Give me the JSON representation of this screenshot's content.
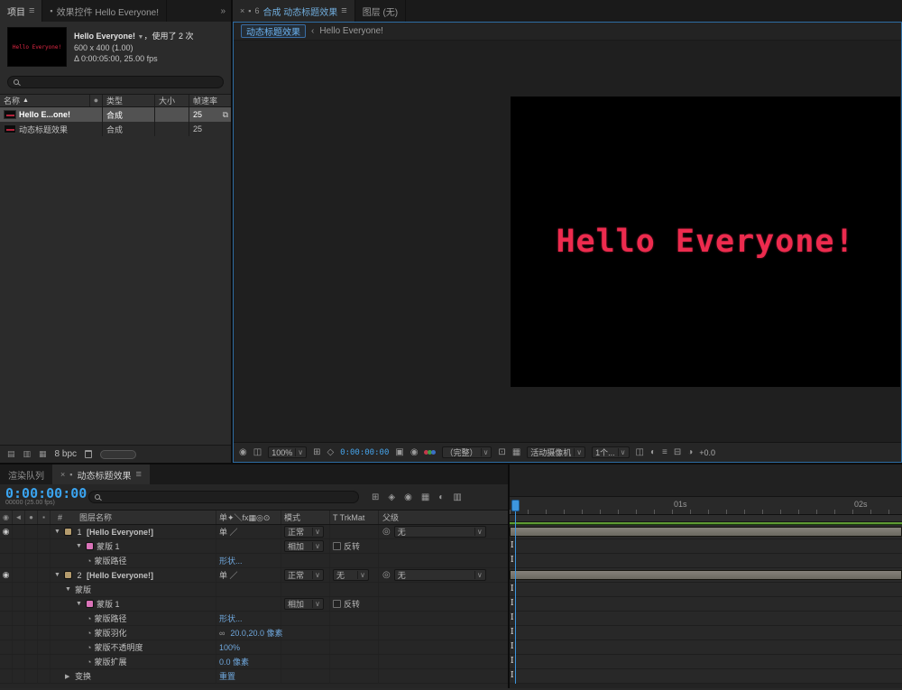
{
  "icons": {
    "menu": "≡",
    "close": "×",
    "overflow": "»",
    "chevron": "∨",
    "sort": "▲",
    "twirl_open": "▼",
    "twirl_closed": "▶",
    "stopwatch": "◔",
    "eye": "◉",
    "pickwhip": "◎",
    "constrain": "∞",
    "crumb_sep": "‹",
    "lock": "6",
    "panel": "▪",
    "eye_head": "◉",
    "audio_head": "◄",
    "solo_head": "●",
    "lock_head": "▪",
    "switches_head": "单✦＼fx▦◎⊙",
    "usage": "⧉",
    "footage": "▤",
    "folder": "▥",
    "newcomp": "▦",
    "snapshot": "▣",
    "show_snapshot": "◉",
    "grid": "⊞",
    "mask_vis": "◇",
    "roi": "⊡",
    "transparency": "▦",
    "pixel_aspect": "◫",
    "fast_preview": "◐",
    "timeline_btn": "≡",
    "flowchart": "⊟",
    "exposure": "◑",
    "mini_flowchart": "⊞",
    "draft3d": "◈",
    "shy": "◉",
    "frame_blend": "▦",
    "motion_blur": "◐",
    "graph_editor": "▥"
  },
  "colors": {
    "accent_blue": "#3d96df",
    "timecode_cyan": "#46a3e9",
    "link_blue": "#6fa7dc",
    "title_red": "#ed2b4e",
    "work_area_green": "#5e9a33",
    "layer_label_tan": "#b49b6d",
    "mask_label_pink": "#d973b8"
  },
  "project": {
    "tabs": {
      "active": "项目",
      "inactive": "效果控件 Hello Everyone!"
    },
    "preview": {
      "name": "Hello Everyone!",
      "usage": "，使用了 2 次",
      "size": "600 x 400 (1.00)",
      "duration": "Δ 0:00:05:00, 25.00 fps",
      "thumb_text": "Hello Everyone!"
    },
    "table": {
      "headers": [
        "名称",
        "类型",
        "大小",
        "帧速率"
      ],
      "rows": [
        {
          "name": "Hello E...one!",
          "type": "合成",
          "size": "",
          "fps": "25",
          "selected": true
        },
        {
          "name": "动态标题效果",
          "type": "合成",
          "size": "",
          "fps": "25",
          "selected": false
        }
      ]
    },
    "footer": {
      "bpc": "8 bpc"
    }
  },
  "viewer": {
    "comp_tab": "合成 动态标题效果",
    "layer_tab": "图层 (无)",
    "crumb_current": "动态标题效果",
    "crumb_parent": "Hello Everyone!",
    "canvas_text": "Hello Everyone!",
    "toolbar": {
      "zoom": "100%",
      "timecode": "0:00:00:00",
      "resolution": "（完整）",
      "camera": "活动摄像机",
      "views": "1个...",
      "exposure": "+0.0"
    }
  },
  "timeline": {
    "tabs": {
      "render_queue": "渲染队列",
      "comp": "动态标题效果"
    },
    "timecode": "0:00:00:00",
    "timecode_sub": "00000 (25.00 fps)",
    "columns": {
      "hash": "#",
      "layer_name": "图层名称",
      "mode": "模式",
      "trkmat": "T TrkMat",
      "parent": "父级"
    },
    "ruler": [
      "01s",
      "02s"
    ],
    "rows": [
      {
        "kind": "layer",
        "eye": true,
        "twirl": "open",
        "swatch": "layer",
        "num": "1",
        "name": "[Hello Everyone!]",
        "switches": "单 ／",
        "mode": "正常",
        "parent": "无",
        "track": "bar",
        "indent": 0
      },
      {
        "kind": "mask",
        "twirl": "open",
        "swatch": "mask",
        "name": "蒙版 1",
        "mask_mode": "相加",
        "invert_label": "反转",
        "track": "mark",
        "indent": 2
      },
      {
        "kind": "prop",
        "stopwatch": true,
        "name": "蒙版路径",
        "value": "形状...",
        "link": true,
        "track": "mark",
        "indent": 3
      },
      {
        "kind": "layer",
        "eye": true,
        "twirl": "open",
        "swatch": "layer",
        "num": "2",
        "name": "[Hello Everyone!]",
        "switches": "单 ／",
        "mode": "正常",
        "trkmat": "无",
        "parent": "无",
        "track": "bar",
        "indent": 0
      },
      {
        "kind": "group",
        "twirl": "open",
        "name": "蒙版",
        "track": "mark",
        "indent": 1
      },
      {
        "kind": "mask",
        "twirl": "open",
        "swatch": "mask",
        "name": "蒙版 1",
        "mask_mode": "相加",
        "invert_label": "反转",
        "track": "mark",
        "indent": 2
      },
      {
        "kind": "prop",
        "stopwatch": true,
        "name": "蒙版路径",
        "value": "形状...",
        "link": true,
        "track": "mark",
        "indent": 3
      },
      {
        "kind": "prop",
        "stopwatch": true,
        "name": "蒙版羽化",
        "value": "20.0,20.0 像素",
        "constrain": true,
        "track": "mark",
        "indent": 3
      },
      {
        "kind": "prop",
        "stopwatch": true,
        "name": "蒙版不透明度",
        "value": "100%",
        "track": "mark",
        "indent": 3
      },
      {
        "kind": "prop",
        "stopwatch": true,
        "name": "蒙版扩展",
        "value": "0.0 像素",
        "track": "mark",
        "indent": 3
      },
      {
        "kind": "group",
        "twirl": "closed",
        "name": "变换",
        "value": "重置",
        "link": true,
        "track": "mark",
        "indent": 1
      }
    ]
  }
}
